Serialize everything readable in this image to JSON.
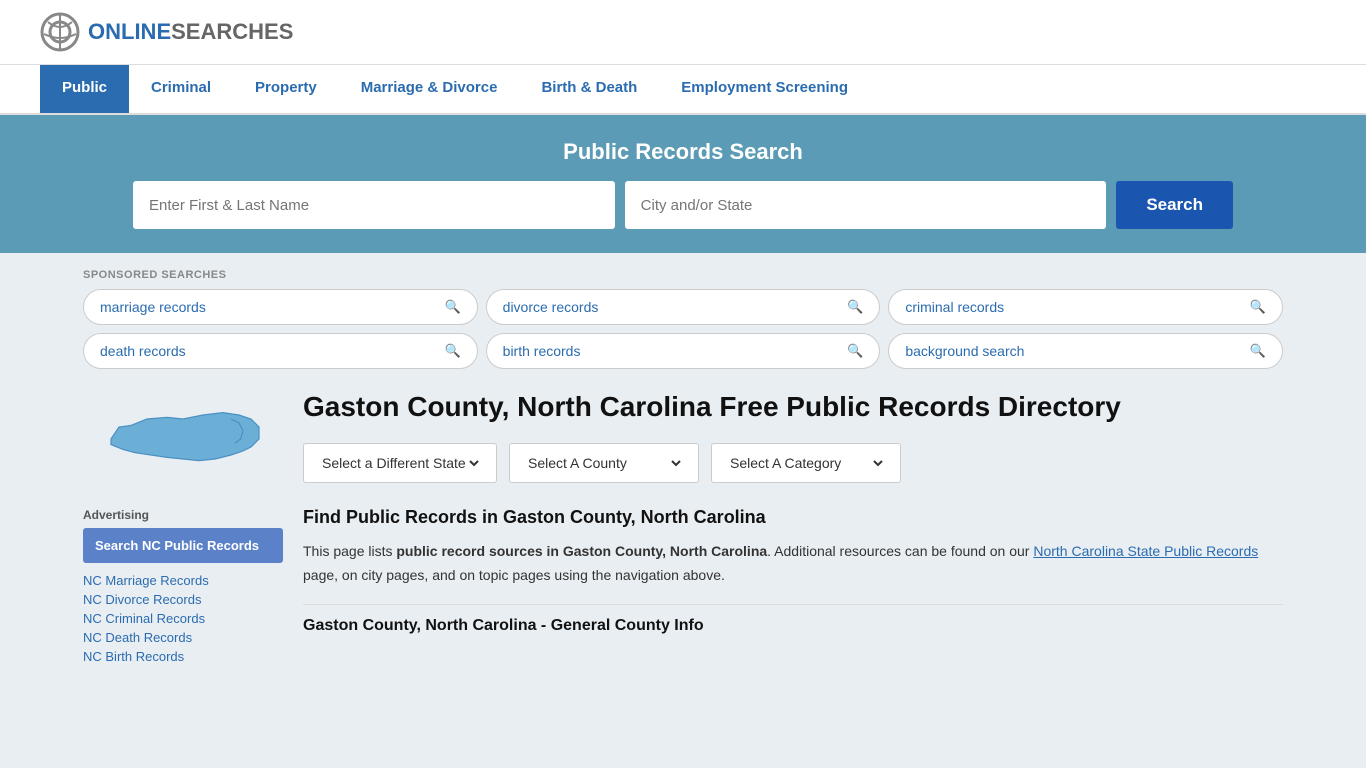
{
  "header": {
    "logo_online": "ONLINE",
    "logo_searches": "SEARCHES"
  },
  "nav": {
    "items": [
      {
        "label": "Public",
        "active": true
      },
      {
        "label": "Criminal",
        "active": false
      },
      {
        "label": "Property",
        "active": false
      },
      {
        "label": "Marriage & Divorce",
        "active": false
      },
      {
        "label": "Birth & Death",
        "active": false
      },
      {
        "label": "Employment Screening",
        "active": false
      }
    ]
  },
  "search_banner": {
    "title": "Public Records Search",
    "name_placeholder": "Enter First & Last Name",
    "location_placeholder": "City and/or State",
    "button_label": "Search"
  },
  "sponsored": {
    "label": "SPONSORED SEARCHES",
    "pills": [
      "marriage records",
      "divorce records",
      "criminal records",
      "death records",
      "birth records",
      "background search"
    ]
  },
  "sidebar": {
    "ad_label": "Advertising",
    "ad_block": "Search NC Public Records",
    "links": [
      "NC Marriage Records",
      "NC Divorce Records",
      "NC Criminal Records",
      "NC Death Records",
      "NC Birth Records"
    ]
  },
  "main": {
    "page_title": "Gaston County, North Carolina Free Public Records Directory",
    "dropdowns": {
      "state": "Select a Different State",
      "county": "Select A County",
      "category": "Select A Category"
    },
    "find_title": "Find Public Records in Gaston County, North Carolina",
    "description_part1": "This page lists ",
    "description_bold": "public record sources in Gaston County, North Carolina",
    "description_part2": ". Additional resources can be found on our ",
    "description_link": "North Carolina State Public Records",
    "description_part3": " page, on city pages, and on topic pages using the navigation above.",
    "section_subtitle": "Gaston County, North Carolina - General County Info"
  }
}
